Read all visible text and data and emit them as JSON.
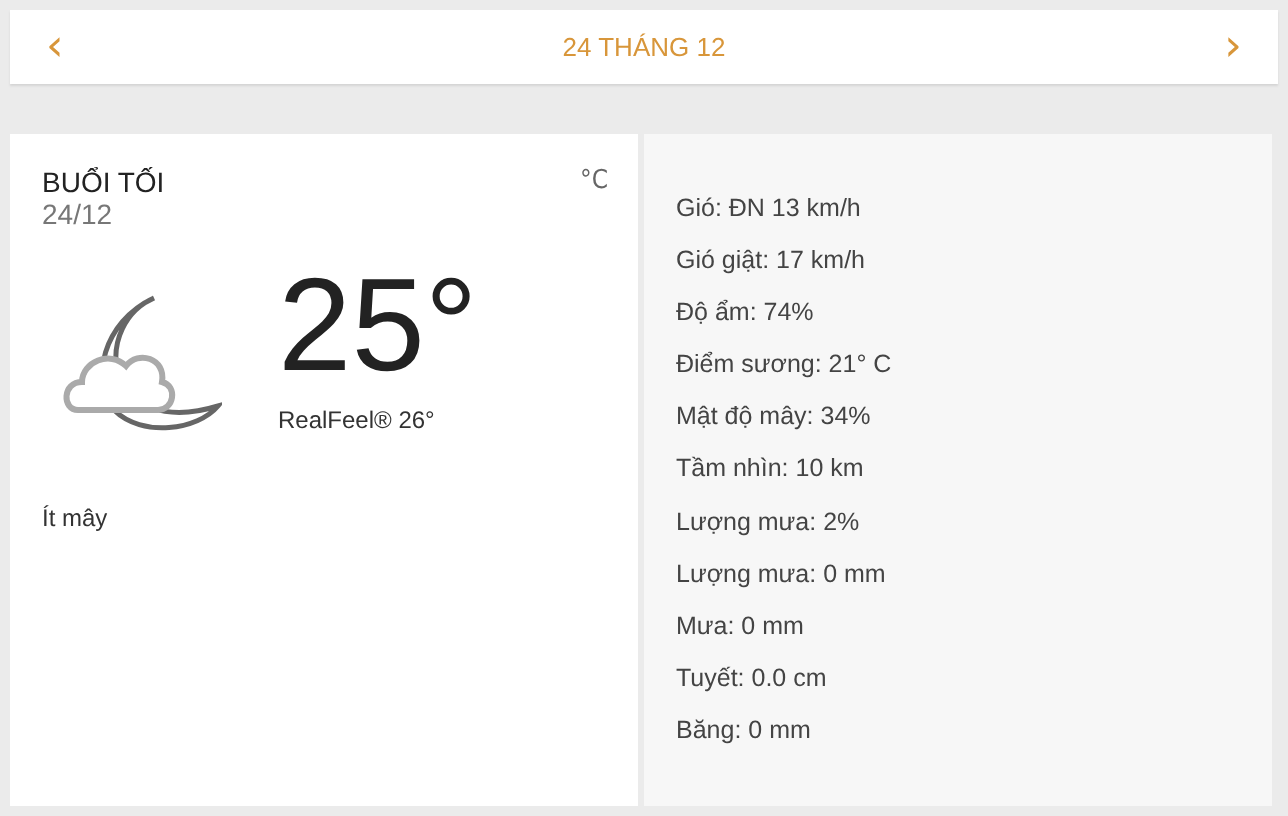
{
  "date_nav": {
    "prev": "‹",
    "title": "24 THÁNG 12",
    "next": "›"
  },
  "current": {
    "period": "BUỔI TỐI",
    "date": "24/12",
    "unit": "°C",
    "temperature": "25°",
    "realfeel": "RealFeel® 26°",
    "condition": "Ít mây"
  },
  "details": [
    "Gió: ĐN 13 km/h",
    "Gió giật: 17 km/h",
    "Độ ẩm: 74%",
    "Điểm sương: 21° C",
    "Mật độ mây: 34%",
    "Tầm nhìn: 10 km",
    "Lượng mưa: 2%",
    "Lượng mưa: 0 mm",
    "Mưa: 0 mm",
    "Tuyết: 0.0 cm",
    "Băng: 0 mm"
  ]
}
